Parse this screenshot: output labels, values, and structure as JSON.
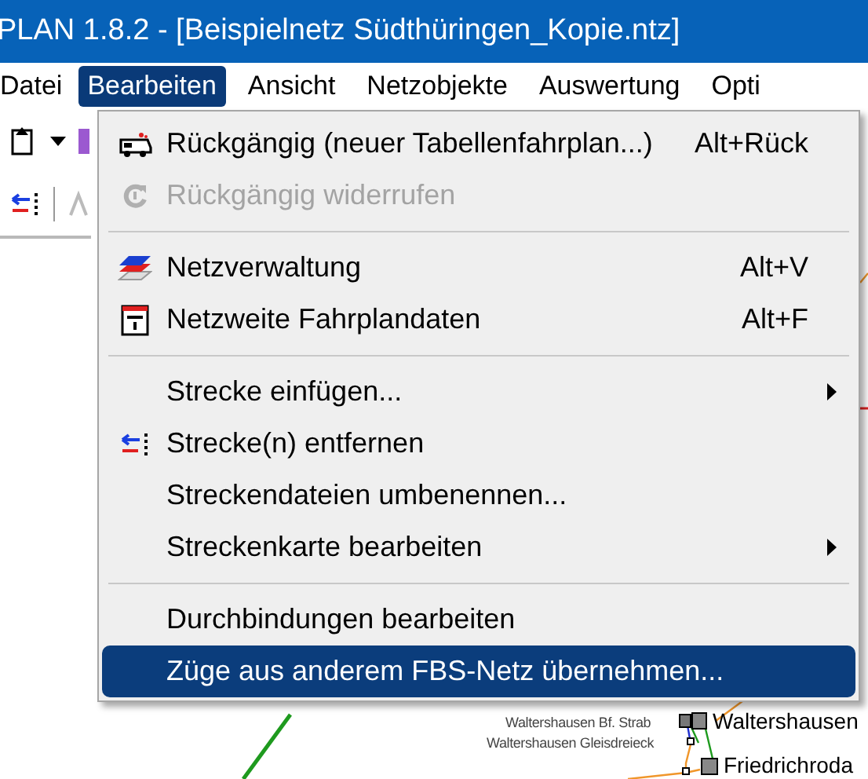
{
  "window": {
    "title": "PLAN 1.8.2 - [Beispielnetz Südthüringen_Kopie.ntz]"
  },
  "menubar": [
    {
      "label": "Datei",
      "selected": false
    },
    {
      "label": "Bearbeiten",
      "selected": true
    },
    {
      "label": "Ansicht",
      "selected": false
    },
    {
      "label": "Netzobjekte",
      "selected": false
    },
    {
      "label": "Auswertung",
      "selected": false
    },
    {
      "label": "Opti",
      "selected": false
    }
  ],
  "menu": [
    {
      "kind": "item",
      "label": "Rückgängig (neuer Tabellenfahrplan...)",
      "shortcut": "Alt+Rück",
      "disabled": false,
      "submenu": false,
      "selected": false
    },
    {
      "kind": "item",
      "label": "Rückgängig widerrufen",
      "disabled": true,
      "submenu": false,
      "selected": false
    },
    {
      "kind": "separator"
    },
    {
      "kind": "item",
      "label": "Netzverwaltung",
      "shortcut": "Alt+V",
      "disabled": false,
      "submenu": false,
      "selected": false
    },
    {
      "kind": "item",
      "label": "Netzweite Fahrplandaten",
      "shortcut": "Alt+F",
      "disabled": false,
      "submenu": false,
      "selected": false
    },
    {
      "kind": "separator"
    },
    {
      "kind": "item",
      "label": "Strecke einfügen...",
      "disabled": false,
      "submenu": true,
      "selected": false
    },
    {
      "kind": "item",
      "label": "Strecke(n) entfernen",
      "disabled": false,
      "submenu": false,
      "selected": false
    },
    {
      "kind": "item",
      "label": "Streckendateien umbenennen...",
      "disabled": false,
      "submenu": false,
      "selected": false
    },
    {
      "kind": "item",
      "label": "Streckenkarte bearbeiten",
      "disabled": false,
      "submenu": true,
      "selected": false
    },
    {
      "kind": "separator"
    },
    {
      "kind": "item",
      "label": "Durchbindungen bearbeiten",
      "disabled": false,
      "submenu": false,
      "selected": false
    },
    {
      "kind": "item",
      "label": "Züge aus anderem FBS-Netz übernehmen...",
      "disabled": false,
      "submenu": false,
      "selected": true
    }
  ],
  "map": {
    "stations": [
      {
        "name": "Waltershausen Bf. Strab",
        "kind": "small"
      },
      {
        "name": "Waltershausen",
        "kind": "large"
      },
      {
        "name": "Waltershausen Gleisdreieck",
        "kind": "small"
      },
      {
        "name": "Friedrichroda",
        "kind": "large"
      }
    ]
  }
}
